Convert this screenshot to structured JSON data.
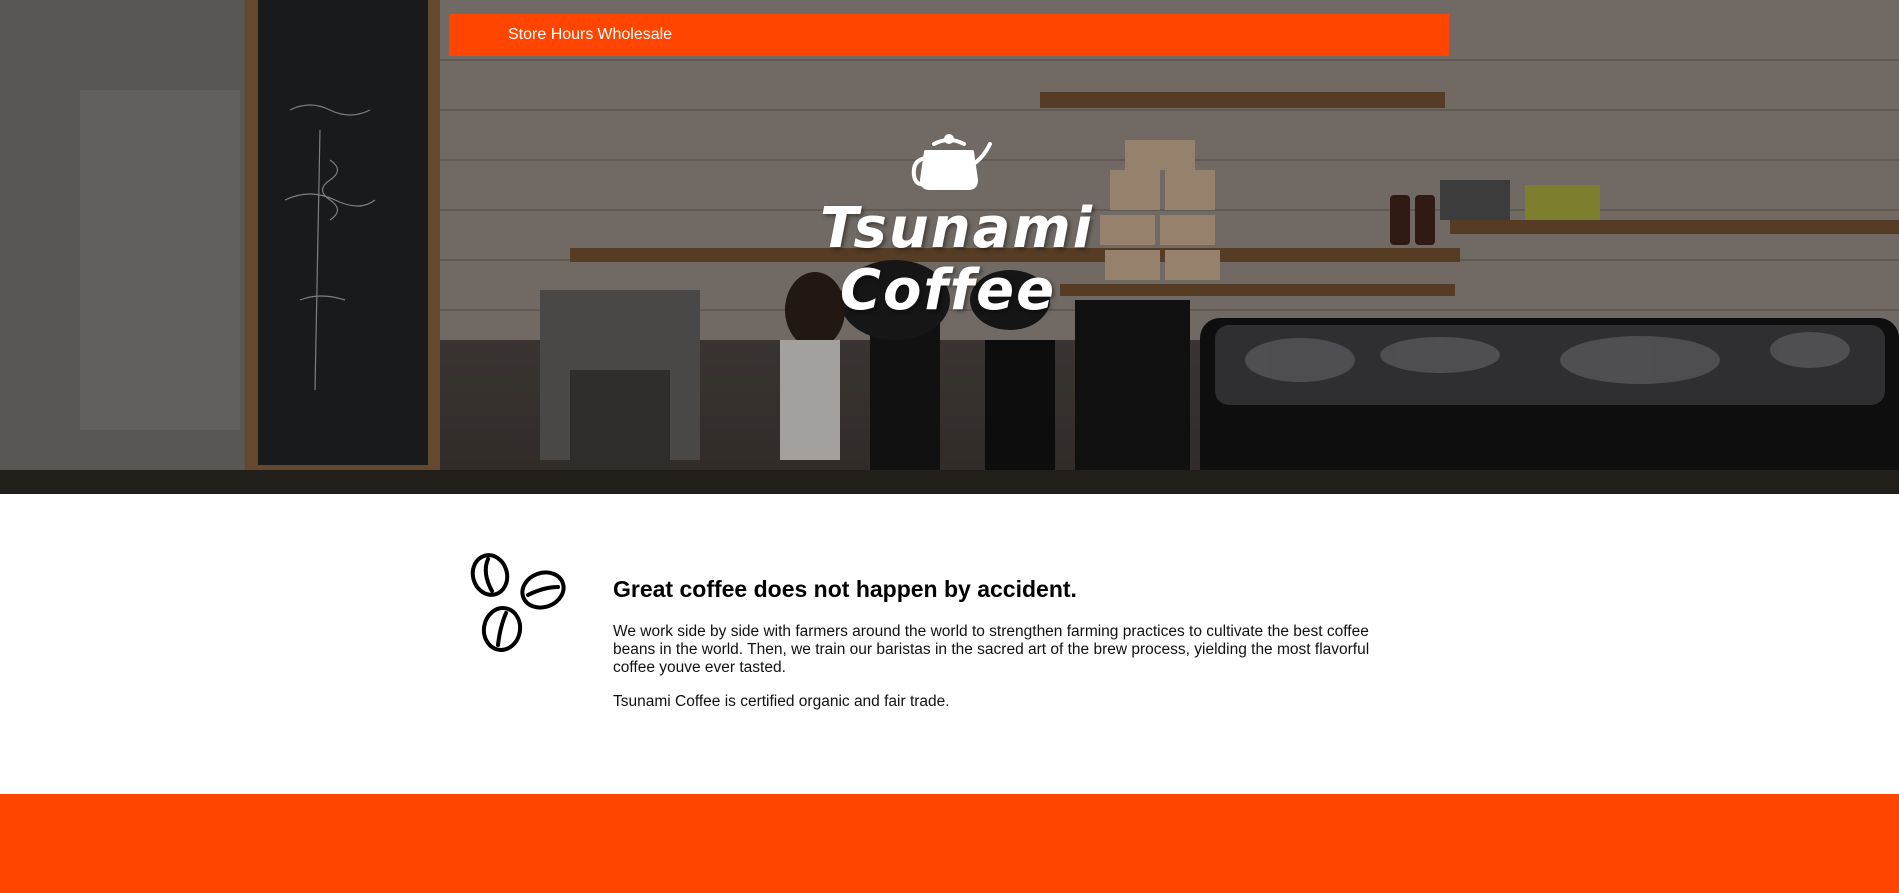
{
  "nav": {
    "items": [
      {
        "label": "Store Hours"
      },
      {
        "label": "Wholesale"
      }
    ]
  },
  "brand": {
    "title_line1": "Tsunami",
    "title_line2": "Coffee",
    "icon": "kettle-icon"
  },
  "intro": {
    "icon": "coffee-beans-icon",
    "heading": "Great coffee does not happen by accident.",
    "paragraphs": [
      "We work side by side with farmers around the world to strengthen farming practices to cultivate the best coffee beans in the world. Then, we train our baristas in the sacred art of the brew process, yielding the most flavorful coffee youve ever tasted.",
      "Tsunami Coffee is certified organic and fair trade."
    ]
  },
  "colors": {
    "accent": "#ff4500",
    "text": "#000000",
    "background": "#ffffff"
  }
}
